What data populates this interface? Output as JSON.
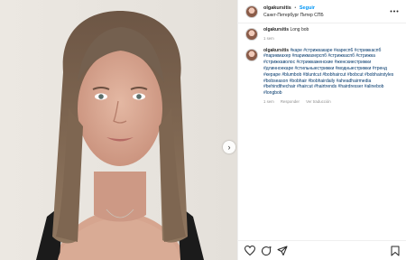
{
  "post": {
    "username": "olgakursitis",
    "separator": "•",
    "follow_label": "Seguir",
    "location": "Санкт-Петербург Питер СПБ"
  },
  "caption": {
    "username": "olgakursitis",
    "text": "Long bob",
    "time": "1 sem"
  },
  "comment": {
    "username": "olgakursitis",
    "text": "#каре #стрижкакаре #каресп6 #стрижкаспб #парикмахер #парикмахерспб #стрижкаспб #стрижка #стрижкаволос #стрижкаженские #женскиестрижки #длинноекаре #стильныестрижки #модныестрижки #тренд #кераре #blumbob #bluntcut #bobhaircut #bobcut #bobhairstyles #bobseason #bobhair #bobhairdaily #aheadhairmedia #behindthechair #haircut #hairtrends #hairdresser #alinebob #longbob",
    "time": "1 sem",
    "reply_label": "Responder",
    "translate_label": "Ver traducción"
  },
  "icons": {
    "more": "more-horizontal-icon",
    "like": "heart-icon",
    "comment": "comment-icon",
    "share": "share-icon",
    "save": "bookmark-icon",
    "next": "chevron-right-icon"
  },
  "colors": {
    "link": "#0095f6",
    "hashtag": "#00376b",
    "meta": "#8e8e8e"
  }
}
